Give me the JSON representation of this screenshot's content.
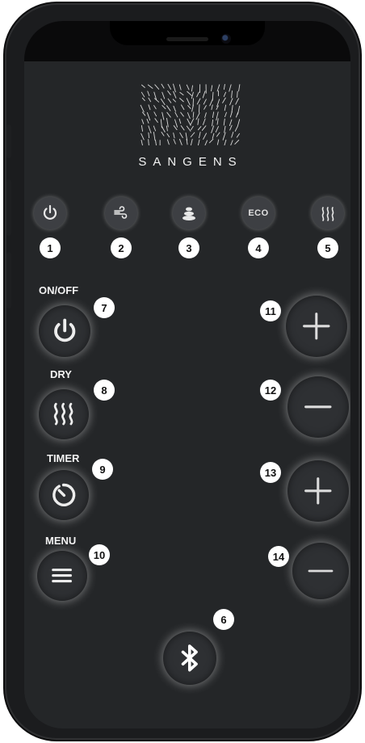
{
  "brand": {
    "name": "SANGENS"
  },
  "modes": [
    {
      "icon": "power-icon",
      "number": "1"
    },
    {
      "icon": "fan-icon",
      "number": "2"
    },
    {
      "icon": "stones-icon",
      "number": "3"
    },
    {
      "icon": "eco-icon",
      "label": "ECO",
      "number": "4"
    },
    {
      "icon": "heat-waves-icon",
      "number": "5"
    }
  ],
  "controls": {
    "onoff": {
      "label": "ON/OFF",
      "number": "7",
      "icon": "power-icon"
    },
    "dry": {
      "label": "DRY",
      "number": "8",
      "icon": "heat-waves-icon"
    },
    "timer": {
      "label": "TIMER",
      "number": "9",
      "icon": "timer-icon"
    },
    "menu": {
      "label": "MENU",
      "number": "10",
      "icon": "menu-icon"
    },
    "plus1": {
      "number": "11",
      "icon": "plus-icon"
    },
    "minus1": {
      "number": "12",
      "icon": "minus-icon"
    },
    "plus2": {
      "number": "13",
      "icon": "plus-icon"
    },
    "minus2": {
      "number": "14",
      "icon": "minus-icon"
    },
    "bluetooth": {
      "number": "6",
      "icon": "bluetooth-icon"
    }
  },
  "colors": {
    "screen_bg": "#242628",
    "button_bg": "#2e3033",
    "badge_bg": "#ffffff"
  }
}
